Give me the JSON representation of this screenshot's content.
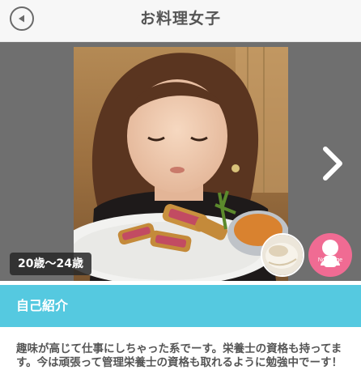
{
  "header": {
    "title": "お料理女子",
    "back_icon": "back-arrow-icon"
  },
  "gallery": {
    "age_label": "20歳〜24歳",
    "next_icon": "chevron-right-icon",
    "thumbnails": [
      {
        "icon": "plate-thumbnail"
      },
      {
        "icon": "no-image-person-icon",
        "label": "No Image"
      }
    ]
  },
  "profile": {
    "section_title": "自己紹介",
    "intro_text": "趣味が高じて仕事にしちゃった系でーす。栄養士の資格も持ってます。今は頑張って管理栄養士の資格も取れるように勉強中でーす！"
  },
  "colors": {
    "accent": "#55c9e0",
    "header_bg": "#f7f7f7",
    "gallery_bg": "#6f6f6f",
    "noimage_pink": "#f06b93"
  }
}
